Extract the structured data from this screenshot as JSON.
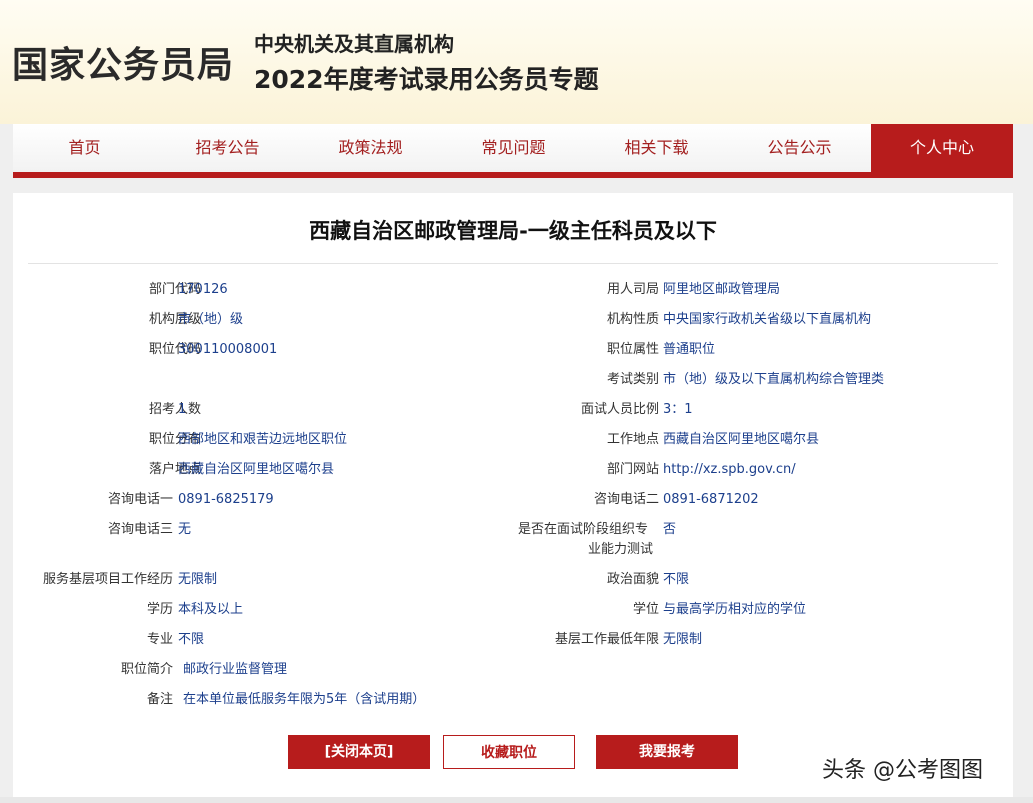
{
  "header": {
    "org": "国家公务员局",
    "line1": "中央机关及其直属机构",
    "line2": "2022年度考试录用公务员专题"
  },
  "nav": [
    "首页",
    "招考公告",
    "政策法规",
    "常见问题",
    "相关下载",
    "公告公示",
    "个人中心"
  ],
  "active_nav": "个人中心",
  "title": "西藏自治区邮政管理局-一级主任科员及以下",
  "fields": {
    "dept_code": {
      "label": "部门代码",
      "value": "170126"
    },
    "employer": {
      "label": "用人司局",
      "value": "阿里地区邮政管理局"
    },
    "org_level": {
      "label": "机构层级",
      "value": "市（地）级"
    },
    "org_nature": {
      "label": "机构性质",
      "value": "中央国家行政机关省级以下直属机构"
    },
    "post_code": {
      "label": "职位代码",
      "value": "300110008001"
    },
    "post_attr": {
      "label": "职位属性",
      "value": "普通职位"
    },
    "exam_type": {
      "label": "考试类别",
      "value": "市（地）级及以下直属机构综合管理类"
    },
    "recruit_num": {
      "label": "招考人数",
      "value": "1"
    },
    "interview_ratio": {
      "label": "面试人员比例",
      "value": "3：1"
    },
    "post_dist": {
      "label": "职位分布",
      "value": "西部地区和艰苦边远地区职位"
    },
    "work_place": {
      "label": "工作地点",
      "value": "西藏自治区阿里地区噶尔县"
    },
    "hukou": {
      "label": "落户地点",
      "value": "西藏自治区阿里地区噶尔县"
    },
    "website": {
      "label": "部门网站",
      "value": "http://xz.spb.gov.cn/"
    },
    "phone1": {
      "label": "咨询电话一",
      "value": "0891-6825179"
    },
    "phone2": {
      "label": "咨询电话二",
      "value": "0891-6871202"
    },
    "phone3": {
      "label": "咨询电话三",
      "value": "无"
    },
    "special_test_l1": "是否在面试阶段组织专",
    "special_test_l2": "业能力测试",
    "special_test_value": "否",
    "grassroots_project": {
      "label": "服务基层项目工作经历",
      "value": "无限制"
    },
    "politics": {
      "label": "政治面貌",
      "value": "不限"
    },
    "education": {
      "label": "学历",
      "value": "本科及以上"
    },
    "degree": {
      "label": "学位",
      "value": "与最高学历相对应的学位"
    },
    "major": {
      "label": "专业",
      "value": "不限"
    },
    "grassroots_years": {
      "label": "基层工作最低年限",
      "value": "无限制"
    },
    "intro": {
      "label": "职位简介",
      "value": "邮政行业监督管理"
    },
    "remarks": {
      "label": "备注",
      "value": "在本单位最低服务年限为5年（含试用期）"
    }
  },
  "buttons": {
    "close": "[关闭本页]",
    "favorite": "收藏职位",
    "apply": "我要报考"
  },
  "watermark": "头条 @公考图图",
  "colors": {
    "accent": "#b71c1c",
    "value_text": "#1c3f8c"
  }
}
